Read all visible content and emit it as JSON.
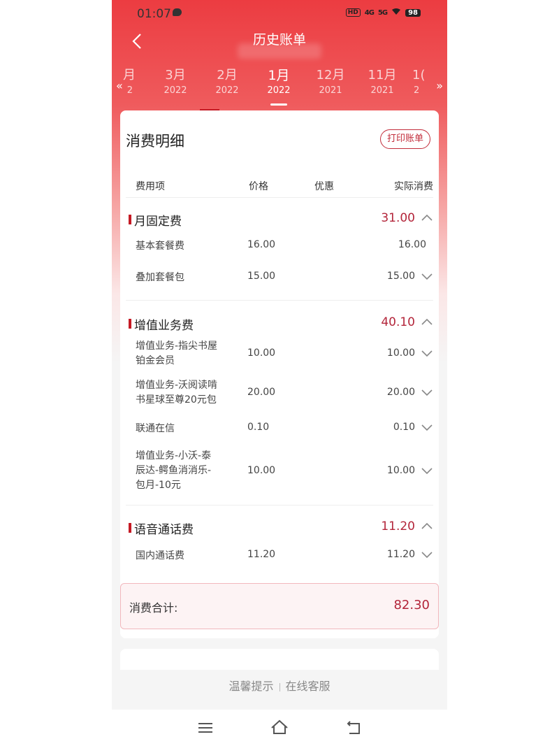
{
  "status": {
    "time": "01:07",
    "battery": "98",
    "hd": "HD",
    "sig1": "4G",
    "sig2": "5G"
  },
  "header": {
    "title": "历史账单"
  },
  "months": [
    {
      "m": "3月",
      "y": "2022",
      "active": false
    },
    {
      "m": "2月",
      "y": "2022",
      "active": false
    },
    {
      "m": "1月",
      "y": "2022",
      "active": true
    },
    {
      "m": "12月",
      "y": "2021",
      "active": false
    },
    {
      "m": "11月",
      "y": "2021",
      "active": false
    }
  ],
  "month_edges": {
    "left_m": "月",
    "left_y": "2",
    "right_m": "1(",
    "right_y": "2"
  },
  "detail": {
    "title": "消费明细",
    "print_button": "打印账单",
    "columns": {
      "item": "费用项",
      "price": "价格",
      "discount": "优惠",
      "actual": "实际消费"
    },
    "sections": [
      {
        "label": "月固定费",
        "total": "31.00",
        "items": [
          {
            "name": "基本套餐费",
            "price": "16.00",
            "actual": "16.00"
          },
          {
            "name": "叠加套餐包",
            "price": "15.00",
            "actual": "15.00"
          }
        ]
      },
      {
        "label": "增值业务费",
        "total": "40.10",
        "items": [
          {
            "name_l1": "增值业务-指尖书屋",
            "name_l2": "铂金会员",
            "price": "10.00",
            "actual": "10.00"
          },
          {
            "name_l1": "增值业务-沃阅读啃",
            "name_l2": "书星球至尊20元包",
            "price": "20.00",
            "actual": "20.00"
          },
          {
            "name": "联通在信",
            "price": "0.10",
            "actual": "0.10"
          },
          {
            "name_l1": "增值业务-小沃-泰",
            "name_l2": "辰达-鳄鱼消消乐-",
            "name_l3": "包月-10元",
            "price": "10.00",
            "actual": "10.00"
          }
        ]
      },
      {
        "label": "语音通话费",
        "total": "11.20",
        "items": [
          {
            "name": "国内通话费",
            "price": "11.20",
            "actual": "11.20"
          }
        ]
      }
    ],
    "sum_label": "消费合计:",
    "sum_value": "82.30"
  },
  "footer": {
    "tips": "温馨提示",
    "service": "在线客服"
  },
  "colors": {
    "brand_red": "#ec3c41",
    "accent": "#b3253a"
  }
}
